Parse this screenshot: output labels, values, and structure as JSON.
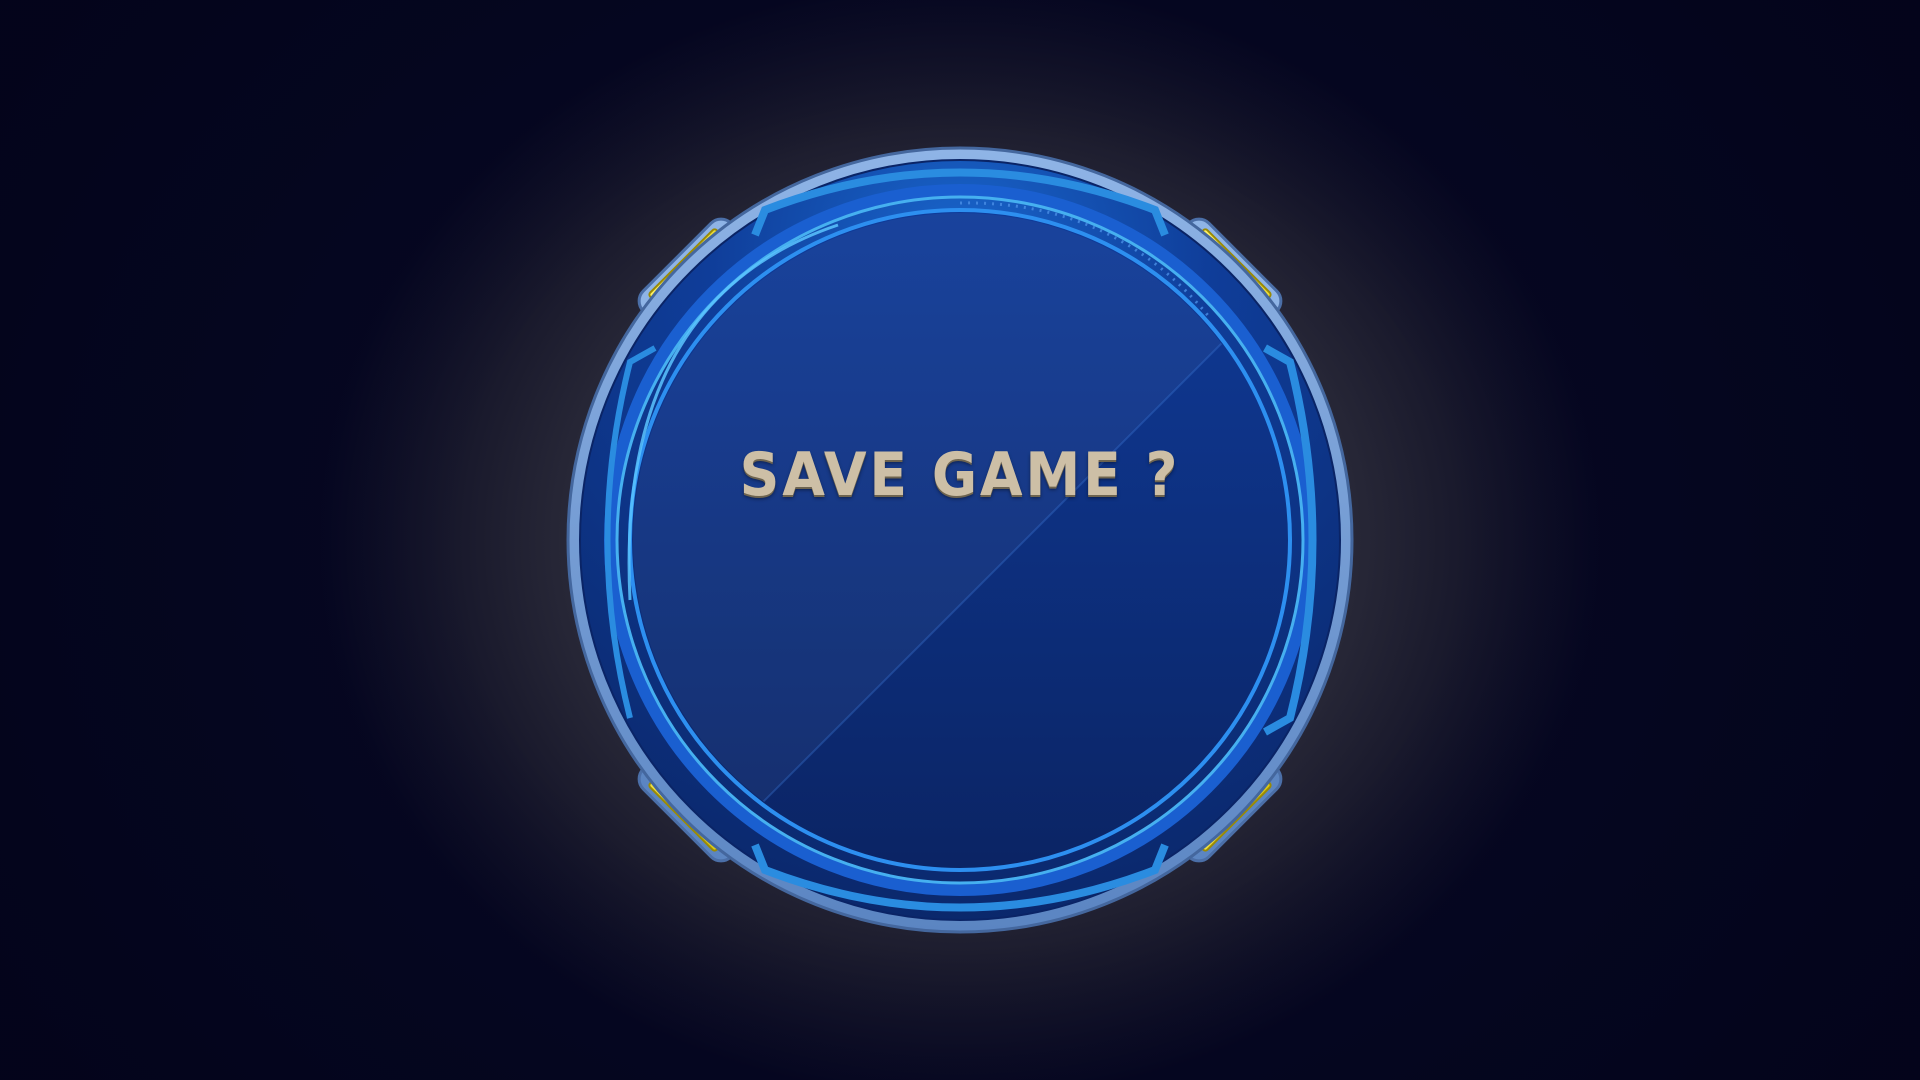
{
  "dialog": {
    "title": "SAVE GAME ?"
  },
  "colors": {
    "background_center": "#54545e",
    "background_edge": "#060722",
    "frame_outer": "#6f9ad6",
    "frame_fill": "#0a2c7e",
    "ring_accent": "#2b86e0",
    "lamp_yellow": "#f5e21a",
    "title_text": "#cdbfa6"
  },
  "icons": {
    "lamp": "corner-lamp-icon"
  }
}
